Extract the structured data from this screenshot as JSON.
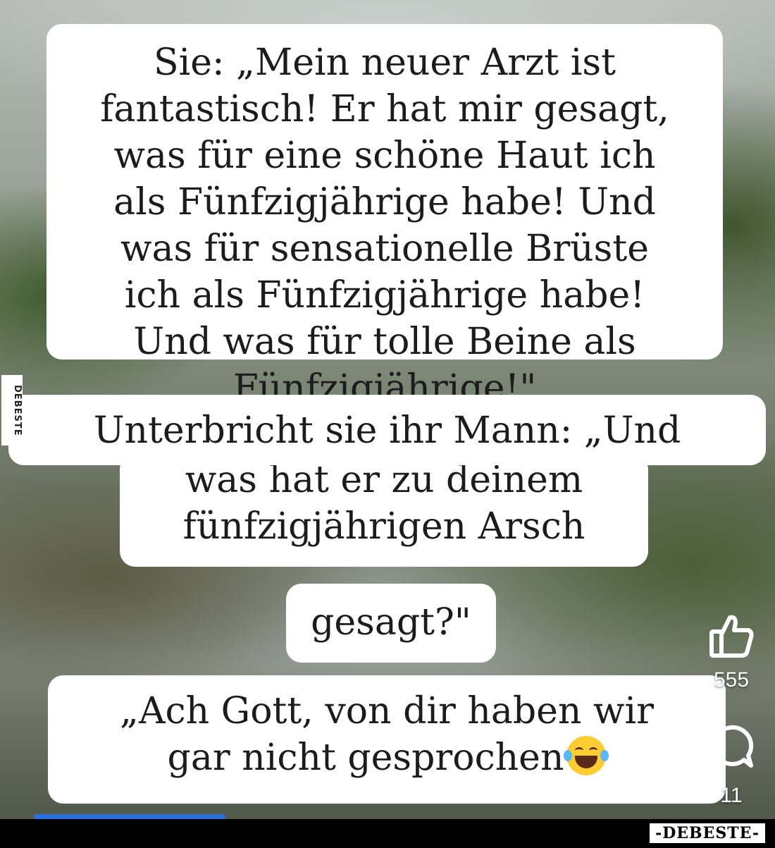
{
  "joke": {
    "bubble1": [
      "Sie: „Mein neuer Arzt ist",
      "fantastisch! Er hat mir gesagt,",
      "was für eine schöne Haut ich",
      "als Fünfzigjährige habe! Und",
      "was für sensationelle Brüste",
      "ich als Fünfzigjährige habe!",
      "Und was für tolle Beine als",
      "Fünfzigjährige!\""
    ],
    "bubble2": "Unterbricht sie ihr Mann: „Und",
    "bubble3": [
      "was hat er zu deinem",
      "fünfzigjährigen Arsch"
    ],
    "bubble4": "gesagt?\"",
    "bubble5": [
      "„Ach Gott, von dir haben wir",
      "gar nicht gesprochen"
    ],
    "emoji": "face-with-tears-of-joy"
  },
  "side_watermark": "DEBESTE",
  "actions": {
    "like_icon": "thumbs-up-icon",
    "like_count": "555",
    "comment_icon": "comment-bubble-icon",
    "comment_count": "11"
  },
  "video": {
    "progress": 0.27
  },
  "footer": {
    "brand": "-DEBESTE-"
  },
  "colors": {
    "bubble": "#ffffff",
    "text": "#1c1c1c",
    "progress": "#2d6fd8",
    "footer": "#000000"
  }
}
